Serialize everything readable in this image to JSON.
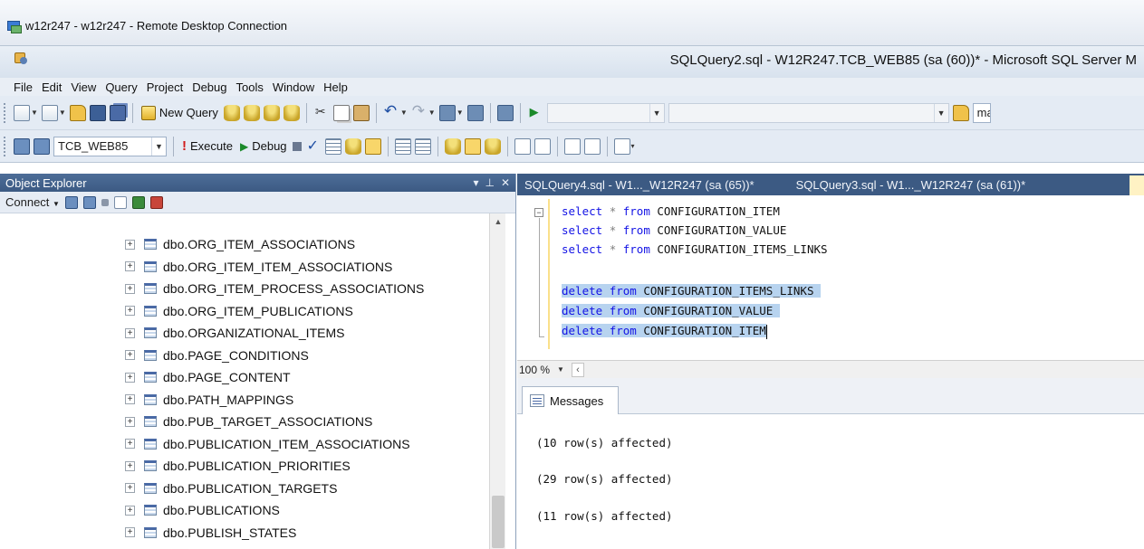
{
  "rdp": {
    "title": "w12r247 - w12r247 - Remote Desktop Connection"
  },
  "ssms": {
    "title": "SQLQuery2.sql - W12R247.TCB_WEB85 (sa (60))* - Microsoft SQL Server M"
  },
  "menu": {
    "items": [
      "File",
      "Edit",
      "View",
      "Query",
      "Project",
      "Debug",
      "Tools",
      "Window",
      "Help"
    ]
  },
  "toolbar1": {
    "new_query_label": "New Query",
    "find_text": "ma"
  },
  "toolbar2": {
    "database": "TCB_WEB85",
    "execute_label": "Execute",
    "debug_label": "Debug"
  },
  "object_explorer": {
    "title": "Object Explorer",
    "connect_label": "Connect",
    "items": [
      "dbo.ORG_ITEM_ASSOCIATIONS",
      "dbo.ORG_ITEM_ITEM_ASSOCIATIONS",
      "dbo.ORG_ITEM_PROCESS_ASSOCIATIONS",
      "dbo.ORG_ITEM_PUBLICATIONS",
      "dbo.ORGANIZATIONAL_ITEMS",
      "dbo.PAGE_CONDITIONS",
      "dbo.PAGE_CONTENT",
      "dbo.PATH_MAPPINGS",
      "dbo.PUB_TARGET_ASSOCIATIONS",
      "dbo.PUBLICATION_ITEM_ASSOCIATIONS",
      "dbo.PUBLICATION_PRIORITIES",
      "dbo.PUBLICATION_TARGETS",
      "dbo.PUBLICATIONS",
      "dbo.PUBLISH_STATES"
    ]
  },
  "tabs": [
    {
      "label": "SQLQuery4.sql - W1..._W12R247 (sa (65))*"
    },
    {
      "label": "SQLQuery3.sql - W1..._W12R247 (sa (61))*"
    }
  ],
  "editor": {
    "lines": [
      {
        "kw1": "select",
        "op": "*",
        "kw2": "from",
        "table": "CONFIGURATION_ITEM"
      },
      {
        "kw1": "select",
        "op": "*",
        "kw2": "from",
        "table": "CONFIGURATION_VALUE"
      },
      {
        "kw1": "select",
        "op": "*",
        "kw2": "from",
        "table": "CONFIGURATION_ITEMS_LINKS"
      },
      {
        "kw1": "delete",
        "kw2": "from",
        "table": "CONFIGURATION_ITEMS_LINKS"
      },
      {
        "kw1": "delete",
        "kw2": "from",
        "table": "CONFIGURATION_VALUE"
      },
      {
        "kw1": "delete",
        "kw2": "from",
        "table": "CONFIGURATION_ITEM"
      }
    ]
  },
  "zoom": {
    "value": "100 %"
  },
  "results": {
    "tab_label": "Messages",
    "messages": [
      "(10 row(s) affected)",
      "(29 row(s) affected)",
      "(11 row(s) affected)"
    ]
  }
}
